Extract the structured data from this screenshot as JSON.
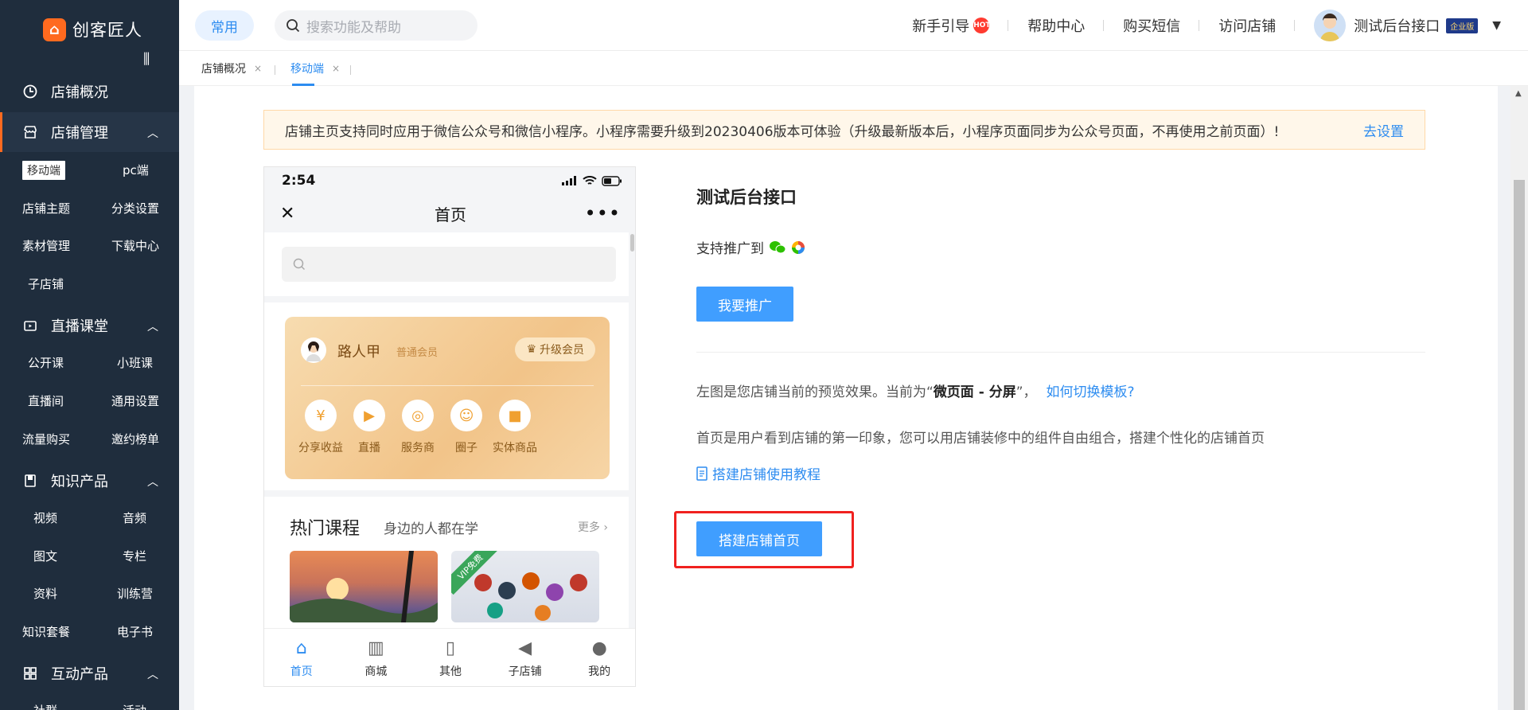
{
  "brand": {
    "name": "创客匠人",
    "logo_glyph": "⌂"
  },
  "sidebar": {
    "collapse_glyph": "⫼",
    "sections": [
      {
        "label": "店铺概况"
      },
      {
        "label": "店铺管理"
      },
      {
        "label": "直播课堂"
      },
      {
        "label": "知识产品"
      },
      {
        "label": "互动产品"
      }
    ],
    "shop_items": [
      "移动端",
      "pc端",
      "店铺主题",
      "分类设置",
      "素材管理",
      "下载中心",
      "子店铺"
    ],
    "live_items": [
      "公开课",
      "小班课",
      "直播间",
      "通用设置",
      "流量购买",
      "邀约榜单"
    ],
    "knowledge_items": [
      "视频",
      "音频",
      "图文",
      "专栏",
      "资料",
      "训练营",
      "知识套餐",
      "电子书"
    ],
    "interactive_items": [
      "社群",
      "活动"
    ]
  },
  "topbar": {
    "common_label": "常用",
    "search_placeholder": "搜索功能及帮助",
    "nav": [
      "新手引导",
      "帮助中心",
      "购买短信",
      "访问店铺"
    ],
    "hot_badge": "HOT",
    "user_name": "测试后台接口",
    "user_badge": "企业版"
  },
  "tabs": [
    {
      "label": "店铺概况"
    },
    {
      "label": "移动端"
    }
  ],
  "notice": {
    "text": "店铺主页支持同时应用于微信公众号和微信小程序。小程序需要升级到20230406版本可体验（升级最新版本后，小程序页面同步为公众号页面，不再使用之前页面）!",
    "link": "去设置"
  },
  "phone": {
    "time": "2:54",
    "title": "首页",
    "member": {
      "name": "路人甲",
      "level": "普通会员",
      "upgrade": "升级会员"
    },
    "member_items": [
      "分享收益",
      "直播",
      "服务商",
      "圈子",
      "实体商品"
    ],
    "hot": {
      "title": "热门课程",
      "subtitle": "身边的人都在学",
      "more": "更多 ›"
    },
    "vip_ribbon": "VIP免费",
    "tabbar": [
      "首页",
      "商城",
      "其他",
      "子店铺",
      "我的"
    ]
  },
  "info": {
    "shop_name": "测试后台接口",
    "promo_label": "支持推广到",
    "promo_button": "我要推广",
    "desc1_prefix": "左图是您店铺当前的预览效果。当前为“",
    "desc1_bold": "微页面 - 分屏",
    "desc1_suffix": "”，",
    "desc1_link": "如何切换模板?",
    "desc2": "首页是用户看到店铺的第一印象，您可以用店铺装修中的组件自由组合，搭建个性化的店铺首页",
    "tutorial": "搭建店铺使用教程",
    "build_button": "搭建店铺首页"
  },
  "colors": {
    "accent": "#409eff",
    "brand": "#ff6a1f",
    "sidebar": "#1f2d3d",
    "highlight": "#f0211f"
  }
}
